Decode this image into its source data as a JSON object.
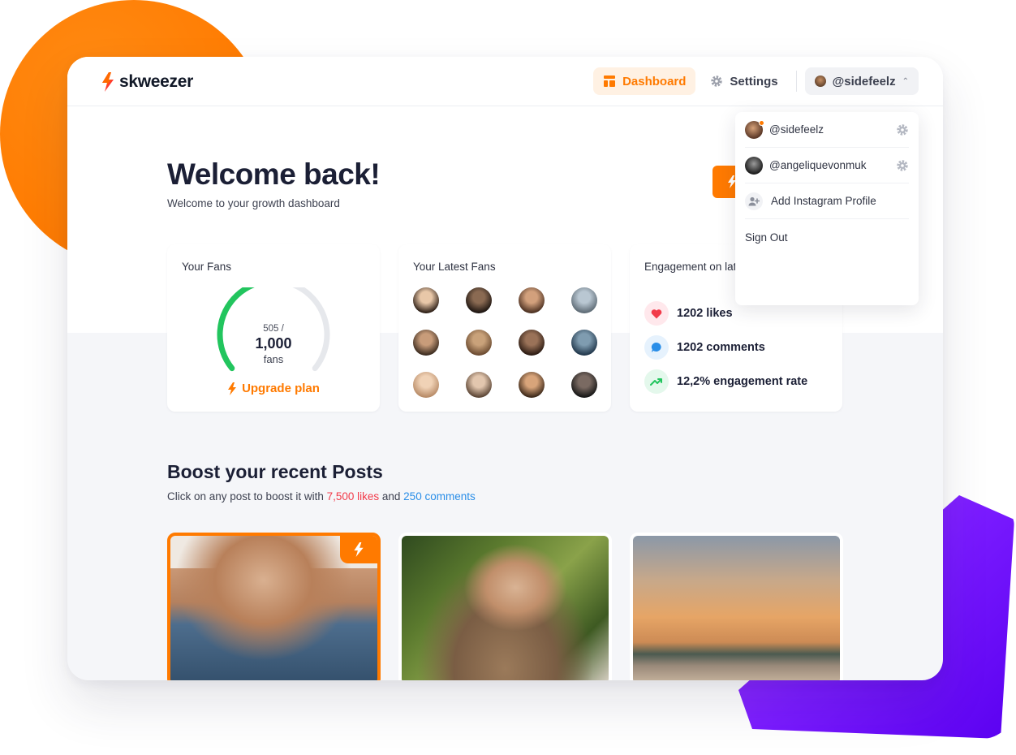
{
  "app": {
    "name": "skweezer"
  },
  "nav": {
    "dashboard": "Dashboard",
    "settings": "Settings",
    "profile": "@sidefeelz"
  },
  "dropdown": {
    "profiles": [
      {
        "handle": "@sidefeelz",
        "active": true
      },
      {
        "handle": "@angeliquevonmuk",
        "active": false
      }
    ],
    "add_profile": "Add Instagram Profile",
    "sign_out": "Sign Out"
  },
  "welcome": {
    "title": "Welcome back!",
    "subtitle": "Welcome to your growth dashboard"
  },
  "cards": {
    "fans": {
      "title": "Your Fans",
      "current": "505 /",
      "limit": "1,000",
      "unit": "fans",
      "progress": 0.505,
      "upgrade": "Upgrade plan"
    },
    "latest_fans": {
      "title": "Your Latest Fans",
      "count": 12
    },
    "engagement": {
      "title": "Engagement on latest Post",
      "likes": "1202 likes",
      "comments": "1202 comments",
      "rate": "12,2% engagement rate"
    }
  },
  "boost": {
    "title": "Boost your recent Posts",
    "subtitle_prefix": "Click on any post to boost it with ",
    "likes": "7,500 likes",
    "and": " and ",
    "comments": "250 comments"
  },
  "colors": {
    "accent": "#ff7a00",
    "likes": "#f23b4a",
    "comments": "#2a8ee8",
    "growth": "#22c55e",
    "secondary_shape": "#7a1bff"
  },
  "icons": {
    "logo": "bolt-icon",
    "dashboard": "layout-icon",
    "settings": "gear-icon",
    "chevron": "chevron-up-icon",
    "add_profile": "user-plus-icon",
    "likes": "heart-icon",
    "comments": "chat-bubble-icon",
    "rate": "trending-up-icon",
    "boost": "bolt-icon"
  }
}
